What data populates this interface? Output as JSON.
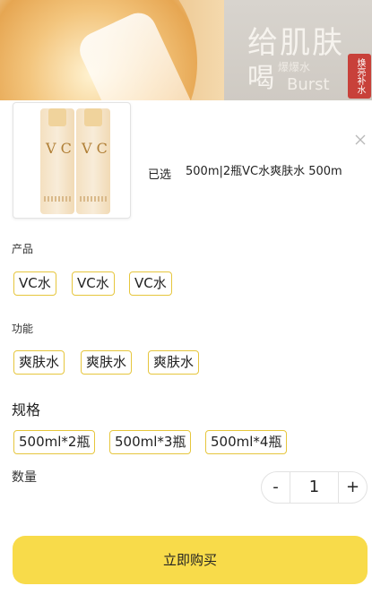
{
  "banner": {
    "line1": "给肌肤",
    "line2": "喝",
    "sub": "爆爆水",
    "sub2": "Burst",
    "seal": "焕亮补水"
  },
  "product": {
    "selected_label": "已选",
    "selected_value": "500m|2瓶VC水爽肤水 500m",
    "bottle_text": "V C"
  },
  "options": {
    "product_title": "产品",
    "product_items": [
      "VC水",
      "VC水",
      "VC水"
    ],
    "function_title": "功能",
    "function_items": [
      "爽肤水",
      "爽肤水",
      "爽肤水"
    ],
    "spec_title": "规格",
    "spec_items": [
      "500ml*2瓶",
      "500ml*3瓶",
      "500ml*4瓶"
    ]
  },
  "quantity": {
    "title": "数量",
    "minus": "-",
    "value": "1",
    "plus": "+"
  },
  "buy_button": "立即购买",
  "colors": {
    "accent": "#f8db4a",
    "chip_border": "#e6c63d"
  }
}
